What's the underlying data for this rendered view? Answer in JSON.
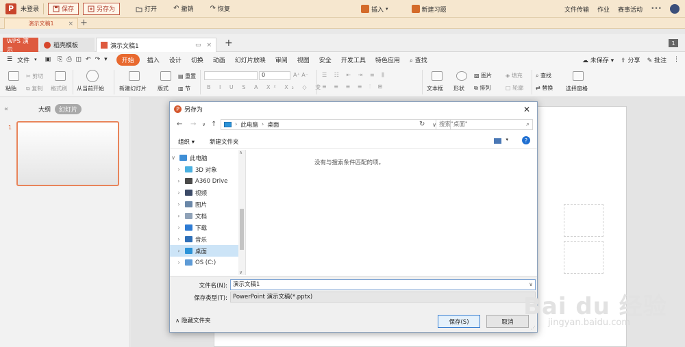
{
  "topbar": {
    "login": "未登录",
    "save": "保存",
    "save_as": "另存为",
    "open": "打开",
    "undo": "撤销",
    "redo": "恢复",
    "insert": "插入",
    "new_question": "新建习题",
    "file_transfer": "文件传输",
    "homework": "作业",
    "activity": "赛事活动"
  },
  "doctab": {
    "title": "演示文稿1"
  },
  "wintabs": {
    "wps": "WPS 演示",
    "shell": "稻壳模板",
    "doc": "演示文稿1",
    "count": "1"
  },
  "menu": {
    "file": "文件",
    "items": [
      "开始",
      "插入",
      "设计",
      "切换",
      "动画",
      "幻灯片放映",
      "审阅",
      "视图",
      "安全",
      "开发工具",
      "特色应用"
    ],
    "search": "查找",
    "unsaved": "未保存",
    "share": "分享",
    "annotate": "批注"
  },
  "ribbon": {
    "cut": "剪切",
    "copy": "复制",
    "format_painter": "格式刷",
    "paste": "粘贴",
    "play_from_current": "从当前开始",
    "new_slide": "新建幻灯片",
    "layout": "版式",
    "section": "节",
    "reset": "重置",
    "font_size": "0",
    "textbox": "文本框",
    "shape": "形状",
    "picture": "图片",
    "fill": "填充",
    "arrange": "排列",
    "outline": "轮廓",
    "find": "查找",
    "replace": "替换",
    "selection_pane": "选择窗格"
  },
  "leftpane": {
    "tab_outline": "大纲",
    "tab_slides": "幻灯片",
    "slide_number": "1"
  },
  "dialog": {
    "title": "另存为",
    "breadcrumb": [
      "此电脑",
      "桌面"
    ],
    "search_placeholder": "搜索\"桌面\"",
    "organize": "组织",
    "new_folder": "新建文件夹",
    "help": "?",
    "nav": [
      {
        "label": "此电脑",
        "icon": "computer-icon",
        "color": "#3f8fd6"
      },
      {
        "label": "3D 对象",
        "icon": "3d-objects-icon",
        "color": "#4ab0e0"
      },
      {
        "label": "A360 Drive",
        "icon": "a360-drive-icon",
        "color": "#4a4a4a"
      },
      {
        "label": "视频",
        "icon": "video-icon",
        "color": "#3b4a67"
      },
      {
        "label": "图片",
        "icon": "pictures-icon",
        "color": "#6a87a8"
      },
      {
        "label": "文档",
        "icon": "documents-icon",
        "color": "#8fa2b8"
      },
      {
        "label": "下载",
        "icon": "download-icon",
        "color": "#2e7bd3"
      },
      {
        "label": "音乐",
        "icon": "music-icon",
        "color": "#2e6fb8"
      },
      {
        "label": "桌面",
        "icon": "desktop-icon",
        "color": "#2b93d8"
      },
      {
        "label": "OS (C:)",
        "icon": "drive-icon",
        "color": "#5e9bd6"
      }
    ],
    "empty_message": "没有与搜索条件匹配的项。",
    "filename_label": "文件名(N):",
    "filename_value": "演示文稿1",
    "filetype_label": "保存类型(T):",
    "filetype_value": "PowerPoint 演示文稿(*.pptx)",
    "hide_folders": "隐藏文件夹",
    "save_button": "保存(S)",
    "cancel_button": "取消"
  },
  "watermark": {
    "brand": "Bai du 经验",
    "url": "jingyan.baidu.com"
  },
  "colors": {
    "accent": "#e8692f",
    "wps_red": "#de5a3f",
    "selection": "#cce4f7"
  }
}
